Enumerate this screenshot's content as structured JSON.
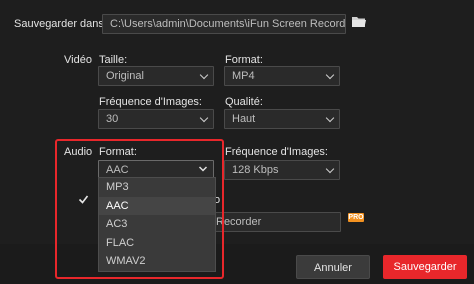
{
  "save_path": {
    "label": "Sauvegarder dans:",
    "value": "C:\\Users\\admin\\Documents\\iFun Screen Recorder\\Output\\"
  },
  "video": {
    "section_label": "Vidéo",
    "size_label": "Taille:",
    "size_value": "Original",
    "format_label": "Format:",
    "format_value": "MP4",
    "fps_label": "Fréquence d'Images:",
    "fps_value": "30",
    "quality_label": "Qualité:",
    "quality_value": "Haut"
  },
  "audio": {
    "section_label": "Audio",
    "format_label": "Format:",
    "format_value": "AAC",
    "fps_label": "Fréquence d'Images:",
    "fps_value": "128 Kbps",
    "format_options": [
      "MP3",
      "AAC",
      "AC3",
      "FLAC",
      "WMAV2"
    ],
    "selected_option": "AAC"
  },
  "partial": {
    "obscured_label_tail": "o",
    "obscured_field_tail": "Recorder",
    "pro_badge": "PRO"
  },
  "buttons": {
    "cancel": "Annuler",
    "save": "Sauvegarder"
  },
  "colors": {
    "accent": "#e8272b",
    "pro": "#f39221",
    "background": "#1e1e1e"
  }
}
